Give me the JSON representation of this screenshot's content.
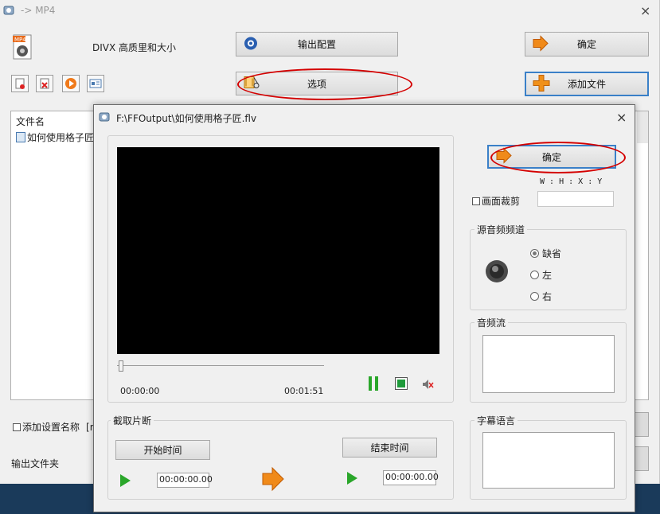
{
  "main": {
    "title": "-> MP4",
    "format_label": "DIVX 高质里和大小",
    "buttons": {
      "output_config": "输出配置",
      "ok": "确定",
      "options": "选项",
      "add_file": "添加文件"
    },
    "filelist": {
      "header": "文件名",
      "items": [
        "如何使用格子匠"
      ]
    },
    "add_setting_name": "添加设置名称",
    "add_setting_bracket": "[n",
    "output_folder": "输出文件夹"
  },
  "dialog": {
    "title": "F:\\FFOutput\\如何使用格子匠.flv",
    "ok": "确定",
    "wh_label": "W : H : X : Y",
    "crop_label": "画面裁剪",
    "time_current": "00:00:00",
    "time_total": "00:01:51",
    "audio_channel": {
      "title": "源音频频道",
      "options": [
        "缺省",
        "左",
        "右"
      ],
      "selected": 0
    },
    "audio_stream_title": "音频流",
    "subtitle_title": "字幕语言",
    "clip": {
      "title": "截取片断",
      "start_label": "开始时间",
      "end_label": "结束时间",
      "start_value": "00:00:00.00",
      "end_value": "00:00:00.00"
    },
    "colors": {
      "highlight_ellipse": "#d40000",
      "focus_border": "#3a80c8",
      "play_green": "#2aa62a",
      "arrow_orange": "#f08a1a"
    }
  }
}
